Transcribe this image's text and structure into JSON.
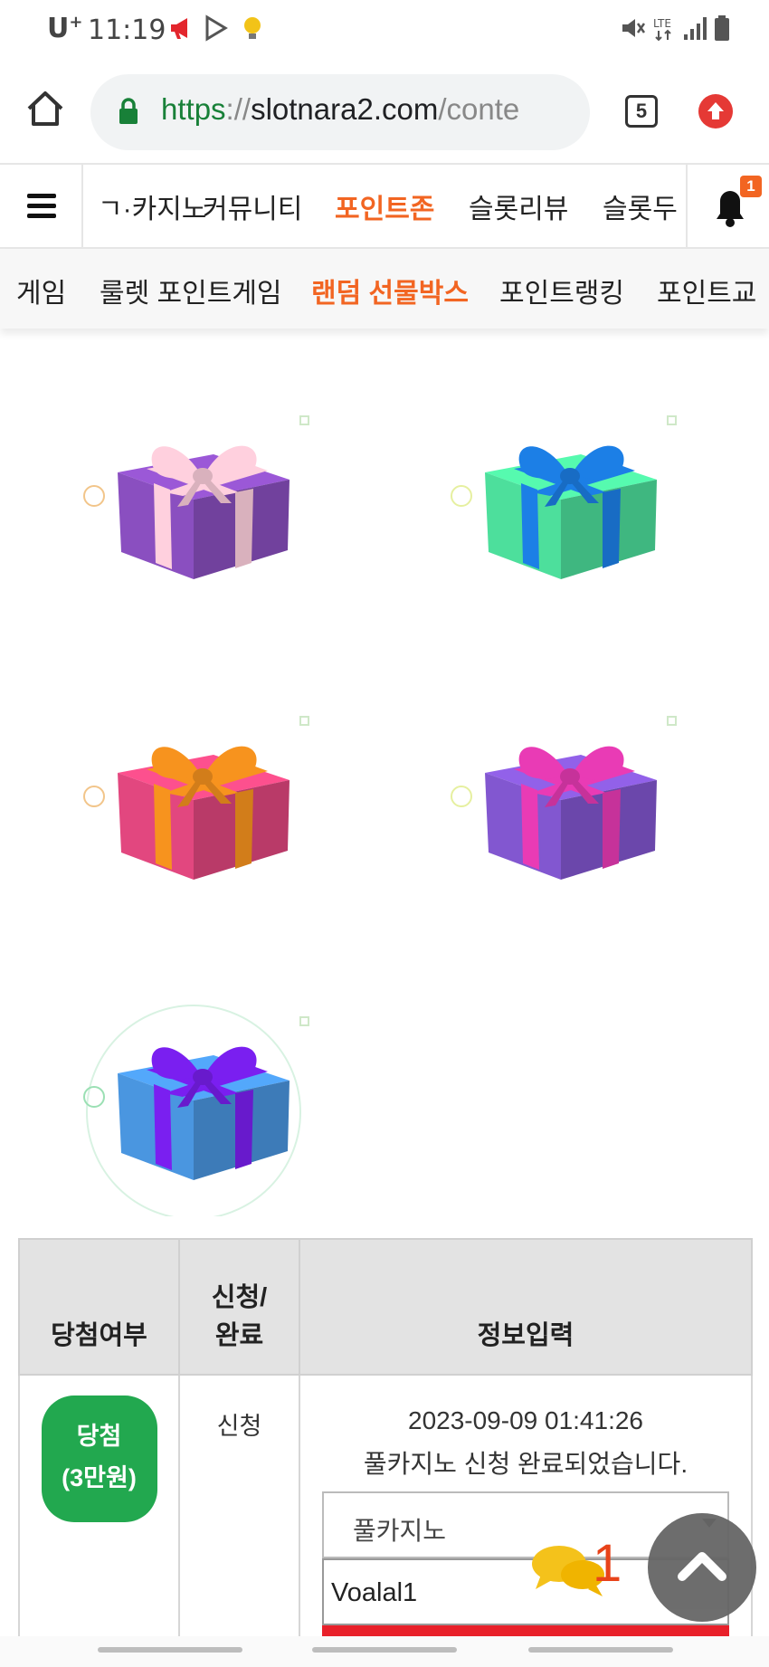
{
  "status_bar": {
    "carrier": "U",
    "carrier_mark": "+",
    "time": "11:19",
    "network": "LTE"
  },
  "browser": {
    "url_scheme": "https",
    "url_sep": "://",
    "url_host": "slotnara2.com",
    "url_path": "/conte",
    "tab_count": "5"
  },
  "main_nav": {
    "items": [
      "ㄱ·카지노",
      "커뮤니티",
      "포인트존",
      "슬롯리뷰",
      "슬롯두"
    ],
    "active": "포인트존",
    "notification_count": "1"
  },
  "sub_nav": {
    "items": [
      "게임",
      "룰렛 포인트게임",
      "랜덤 선물박스",
      "포인트랭킹",
      "포인트교"
    ],
    "active": "랜덤 선물박스"
  },
  "gifts": [
    {
      "box": "#8a4fc0",
      "ribbon": "#ffd0de",
      "name": "purple-pink"
    },
    {
      "box": "#4ddf9c",
      "ribbon": "#1c7fe6",
      "name": "green-blue"
    },
    {
      "box": "#e2477f",
      "ribbon": "#f7931e",
      "name": "pink-orange"
    },
    {
      "box": "#8257d0",
      "ribbon": "#e93bb5",
      "name": "violet-magenta"
    },
    {
      "box": "#4a96e0",
      "ribbon": "#7a1ff0",
      "name": "blue-purple"
    }
  ],
  "table": {
    "headers": {
      "result": "당첨여부",
      "status_line1": "신청/",
      "status_line2": "완료",
      "info": "정보입력"
    },
    "row": {
      "result_line1": "당첨",
      "result_line2": "(3만원)",
      "status": "신청",
      "date": "2023-09-09 01:41:26",
      "message": "풀카지노 신청 완료되었습니다.",
      "casino_selected": "풀카지노",
      "user_id": "Voalal1"
    }
  },
  "chat": {
    "count": "1"
  },
  "colors": {
    "accent": "#f26522",
    "win": "#22a84f",
    "submit": "#e8202a"
  }
}
